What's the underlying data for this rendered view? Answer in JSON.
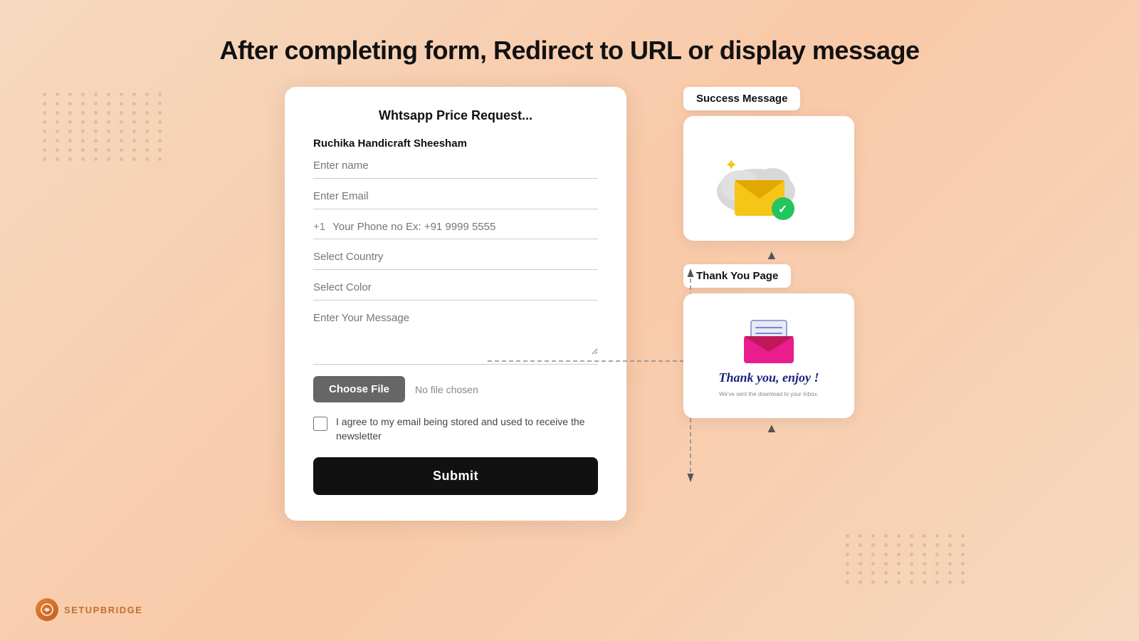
{
  "page": {
    "heading": "After completing form, Redirect to URL or display message"
  },
  "form": {
    "title": "Whtsapp Price Request...",
    "subtitle": "Ruchika Handicraft Sheesham",
    "fields": {
      "name_placeholder": "Enter name",
      "email_placeholder": "Enter Email",
      "phone_code": "+1",
      "phone_placeholder": "Your Phone no Ex: +91 9999 5555",
      "country_placeholder": "Select Country",
      "color_placeholder": "Select Color",
      "message_placeholder": "Enter Your Message"
    },
    "file_button": "Choose File",
    "file_none": "No file chosen",
    "checkbox_label": "I agree to my email being stored and used to receive the newsletter",
    "submit_label": "Submit"
  },
  "flow": {
    "success_label": "Success Message",
    "thankyou_label": "Thank You Page",
    "thankyou_text": "Thank you, enjoy !",
    "thankyou_subtext": "We've sent the download to your Inbox."
  },
  "brand": {
    "name": "SETUPBRIDGE"
  }
}
